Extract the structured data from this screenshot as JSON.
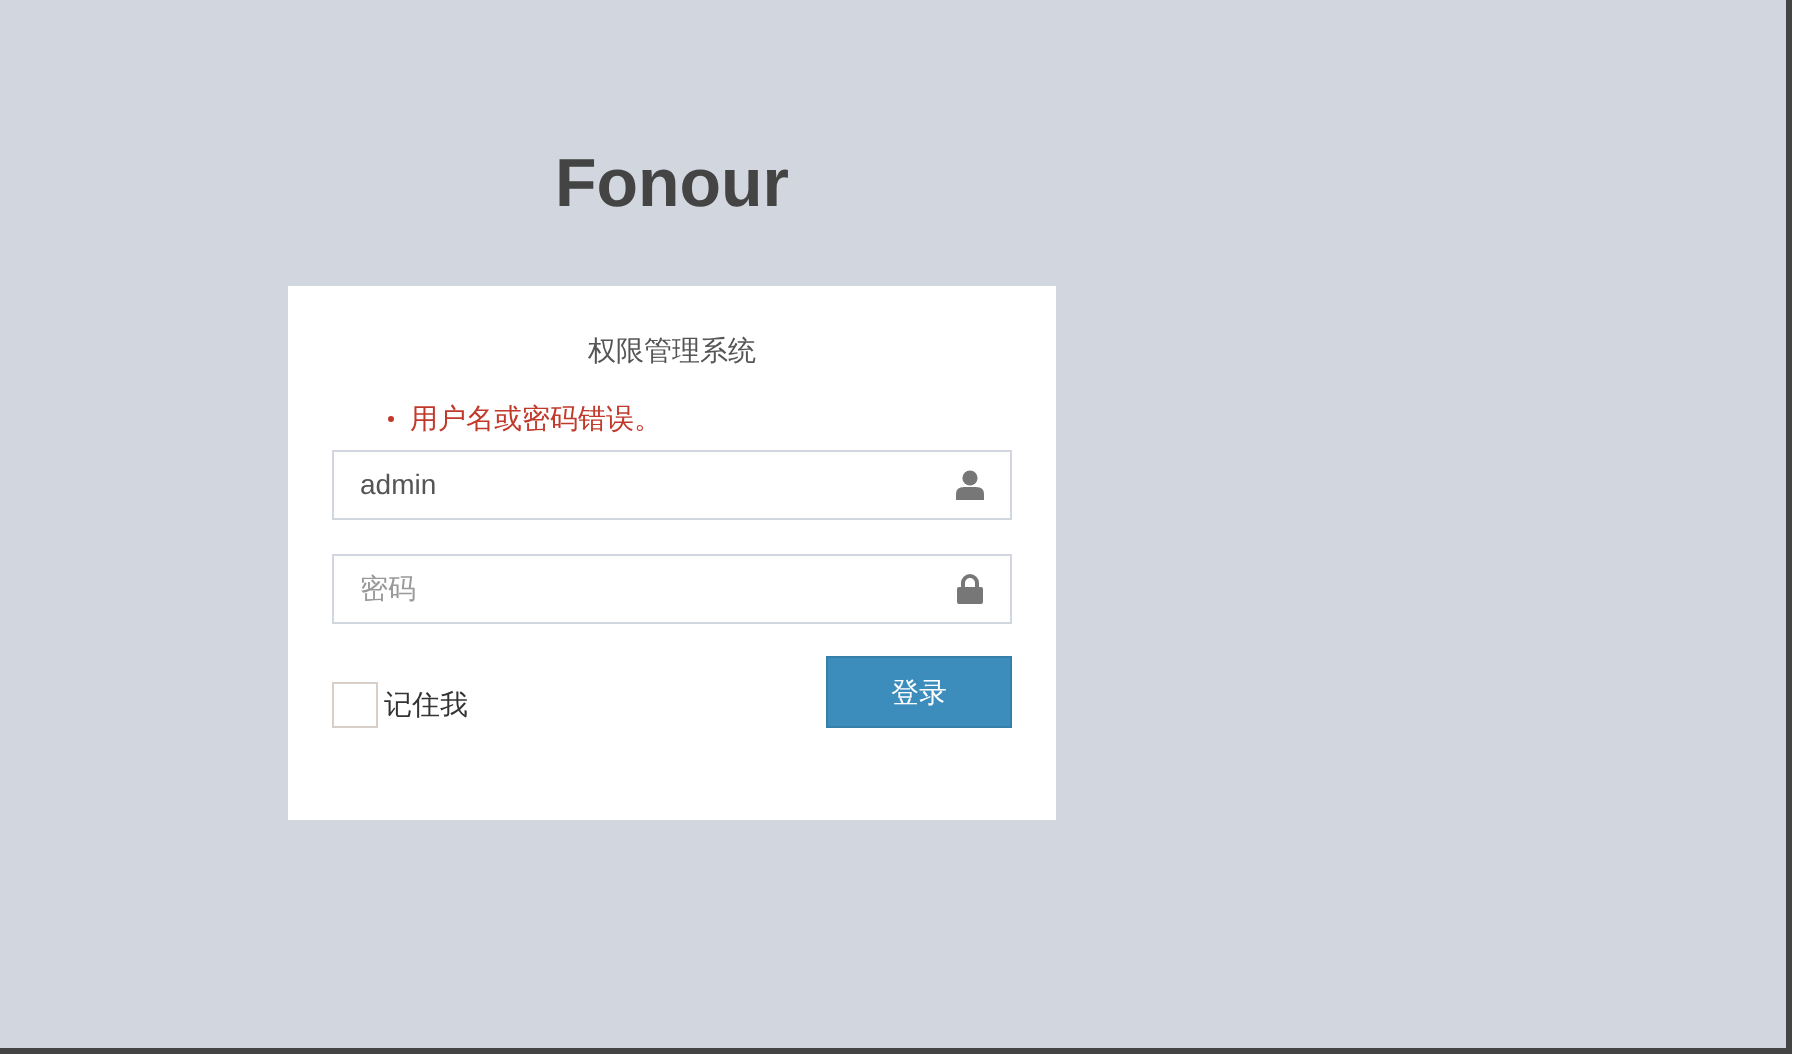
{
  "logo": "Fonour",
  "login_box": {
    "title": "权限管理系统",
    "errors": [
      "用户名或密码错误。"
    ],
    "username": {
      "value": "admin"
    },
    "password": {
      "placeholder": "密码"
    },
    "remember_me": {
      "label": "记住我",
      "checked": false
    },
    "submit_button": "登录"
  }
}
